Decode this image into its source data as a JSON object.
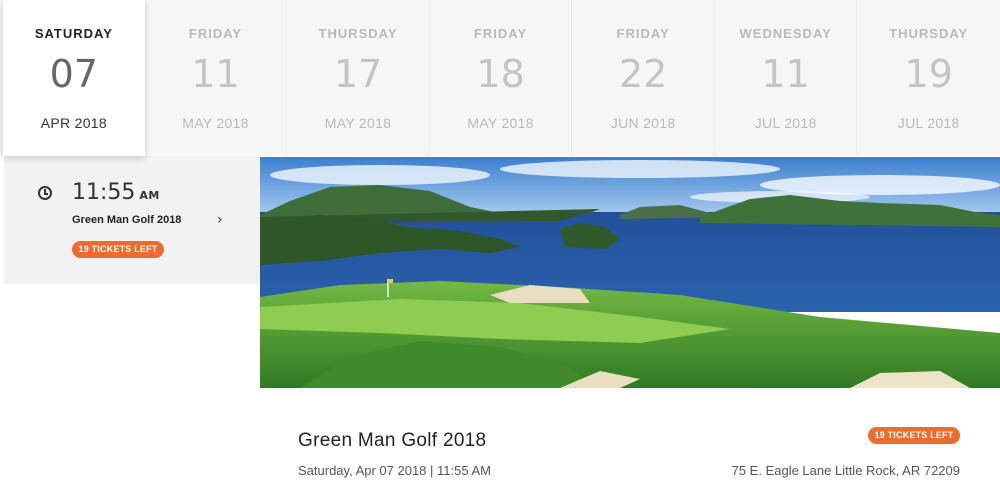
{
  "dates": [
    {
      "weekday": "SATURDAY",
      "day": "07",
      "month": "APR 2018",
      "active": true
    },
    {
      "weekday": "FRIDAY",
      "day": "11",
      "month": "MAY 2018",
      "active": false
    },
    {
      "weekday": "THURSDAY",
      "day": "17",
      "month": "MAY 2018",
      "active": false
    },
    {
      "weekday": "FRIDAY",
      "day": "18",
      "month": "MAY 2018",
      "active": false
    },
    {
      "weekday": "FRIDAY",
      "day": "22",
      "month": "JUN 2018",
      "active": false
    },
    {
      "weekday": "WEDNESDAY",
      "day": "11",
      "month": "JUL 2018",
      "active": false
    },
    {
      "weekday": "THURSDAY",
      "day": "19",
      "month": "JUL 2018",
      "active": false
    }
  ],
  "session": {
    "icon": "clock-icon",
    "time": "11:55",
    "ampm": "AM",
    "name": "Green Man Golf 2018",
    "badge": "19 TICKETS LEFT",
    "chevron_icon": "chevron-right-icon"
  },
  "event": {
    "title": "Green Man Golf 2018",
    "datetime": "Saturday, Apr 07 2018 | 11:55 AM",
    "badge": "19 TICKETS LEFT",
    "address": "75 E. Eagle Lane Little Rock, AR 72209"
  },
  "colors": {
    "accent": "#ec6b2d",
    "strip_bg": "#f6f6f6",
    "panel_bg": "#f2f2f2"
  }
}
